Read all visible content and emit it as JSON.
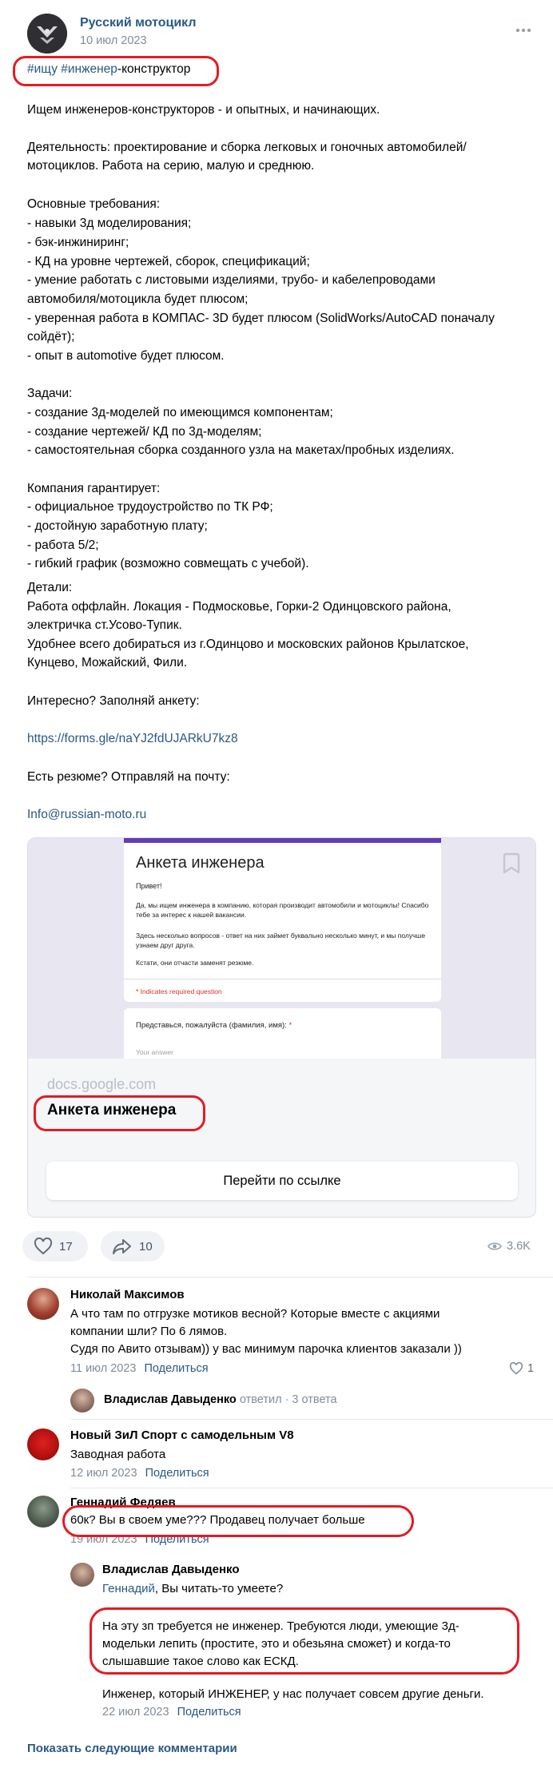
{
  "header": {
    "community_name": "Русский мотоцикл",
    "date": "10 июл 2023",
    "more_icon": "more-dots-icon"
  },
  "tags": {
    "tag1": "#ищу",
    "tag2": "#инженер",
    "tag_suffix": "-конструктор"
  },
  "post": {
    "lines": [
      "Ищем инженеров-конструкторов - и опытных, и начинающих.",
      "Деятельность: проектирование и сборка легковых и гоночных автомобилей/",
      "мотоциклов. Работа на серию, малую и среднюю.",
      "Основные требования:",
      "- навыки 3д моделирования;",
      "- бэк-инжиниринг;",
      "- КД на уровне чертежей, сборок, спецификаций;",
      "- умение работать с листовыми изделиями, трубо- и кабелепроводами",
      "автомобиля/мотоцикла будет плюсом;",
      "- уверенная работа в КОМПАС- 3D будет плюсом (SolidWorks/AutoCAD поначалу",
      "сойдёт);",
      "- опыт в automotive будет плюсом.",
      "Задачи:",
      "- создание 3д-моделей по имеющимся компонентам;",
      "- создание чертежей/ КД по 3д-моделям;",
      "- самостоятельная сборка созданного узла на макетах/пробных изделиях.",
      "Компания гарантирует:",
      "- официальное трудоустройство по ТК РФ;",
      "- достойную заработную плату;",
      "- работа 5/2;",
      "- гибкий график (возможно совмещать с учебой).",
      "Детали:",
      "Работа оффлайн. Локация - Подмосковье, Горки-2 Одинцовского района,",
      "электричка ст.Усово-Тупик.",
      "Удобнее всего добираться из г.Одинцово и московских районов Крылатское,",
      "Кунцево, Можайский, Фили.",
      "Интересно? Заполняй анкету:",
      "Есть резюме? Отправляй на почту:"
    ],
    "form_link": "https://forms.gle/naYJ2fdUJARkU7kz8",
    "email_link": "Info@russian-moto.ru"
  },
  "snippet": {
    "form_title": "Анкета инженера",
    "form_greeting": "Привет!",
    "form_p1": "Да, мы ищем инженера в компанию, которая производит автомобили и мотоциклы! Спасибо тебе за интерес к нашей вакансии.",
    "form_p2": "Здесь несколько вопросов - ответ на них займет буквально несколько минут, и мы получше узнаем друг друга.",
    "form_p3": "Кстати, они отчасти заменят резюме.",
    "form_required": "* Indicates required question",
    "form_q1": "Представься, пожалуйста (фамилия, имя):",
    "form_q1_star": "*",
    "form_answer_placeholder": "Your answer",
    "domain": "docs.google.com",
    "title": "Анкета инженера",
    "button": "Перейти по ссылке",
    "bookmark_icon": "bookmark-icon"
  },
  "actions": {
    "likes": "17",
    "shares": "10",
    "views": "3.6K"
  },
  "comments": [
    {
      "name": "Николай Максимов",
      "lines": [
        "А что там по отгрузке мотиков весной? Которые вместе с акциями",
        "компании шли? По 6 лямов.",
        "Судя по Авито отзывам)) у вас минимум парочка клиентов заказали ))"
      ],
      "date": "11 июл 2023",
      "share": "Поделиться",
      "likes": "1",
      "reply_name": "Владислав Давыденко",
      "reply_info": "ответил · 3 ответа"
    },
    {
      "name": "Новый ЗиЛ Спорт с самодельным V8",
      "lines": [
        "Заводная работа"
      ],
      "date": "12 июл 2023",
      "share": "Поделиться"
    },
    {
      "name": "Геннадий Федяев",
      "lines": [
        "60к? Вы в своем уме??? Продавец получает больше"
      ],
      "date": "19 июл 2023",
      "share": "Поделиться"
    }
  ],
  "reply": {
    "name": "Владислав Давыденко",
    "mention": "Геннадий",
    "first_line": ", Вы читать-то умеете?",
    "lines": [
      "На эту зп требуется не инженер. Требуются люди, умеющие 3д-",
      "модельки лепить (простите, это и обезьяна сможет) и когда-то",
      "слышавшие такое слово как ЕСКД."
    ],
    "last_line": "Инженер, который ИНЖЕНЕР, у нас получает совсем другие деньги.",
    "date": "22 июл 2023",
    "share": "Поделиться"
  },
  "show_more": "Показать следующие комментарии",
  "colors": {
    "link": "#2a5885",
    "muted": "#818c99",
    "highlight": "#e31b23",
    "snippet_bg": "#f3f4f7",
    "form_purple": "#673ab7"
  }
}
